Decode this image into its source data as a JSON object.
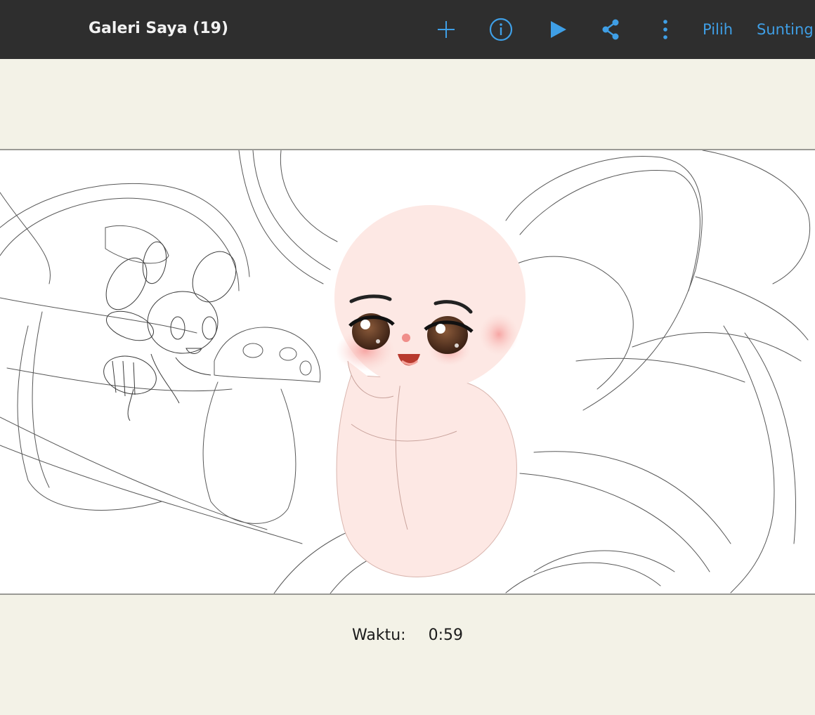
{
  "header": {
    "title": "Galeri Saya (19)",
    "icons": [
      "add-icon",
      "info-icon",
      "play-icon",
      "share-icon",
      "more-vertical-icon"
    ],
    "select_label": "Pilih",
    "edit_label": "Sunting"
  },
  "footer": {
    "time_label": "Waktu:",
    "time_value": "0:59"
  },
  "colors": {
    "topbar_bg": "#2e2e2e",
    "accent": "#3f9fe6",
    "page_bg": "#f3f2e7",
    "canvas_bg": "#ffffff"
  }
}
